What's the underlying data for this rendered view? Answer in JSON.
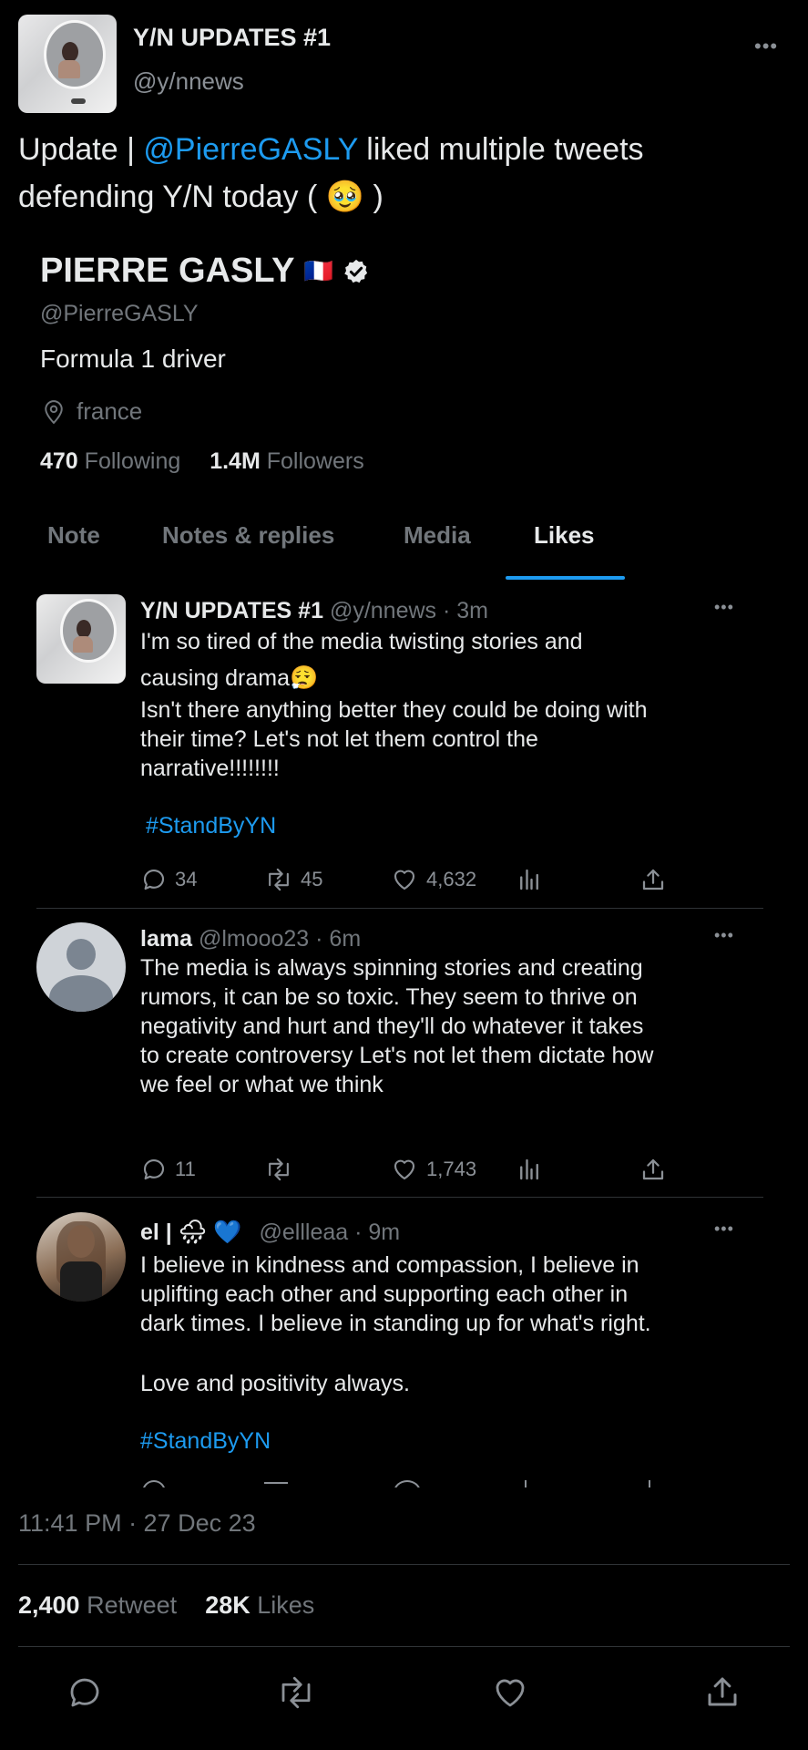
{
  "header": {
    "display_name": "Y/N UPDATES #1",
    "handle": "@y/nnews",
    "more_label": "•••"
  },
  "tweet": {
    "text_before": "Update | ",
    "mention": "@PierreGASLY",
    "text_after": " liked multiple tweets defending Y/N today ( 🥹 )"
  },
  "profile": {
    "name": "PIERRE GASLY",
    "flag": "🇫🇷",
    "handle": "@PierreGASLY",
    "bio": "Formula 1 driver",
    "location": "france",
    "following_count": "470",
    "following_label": "Following",
    "followers_count": "1.4M",
    "followers_label": "Followers",
    "tabs": [
      {
        "label": "Note",
        "active": false
      },
      {
        "label": "Notes & replies",
        "active": false
      },
      {
        "label": "Media",
        "active": false
      },
      {
        "label": "Likes",
        "active": true
      }
    ],
    "accent_color": "#1d9bf0"
  },
  "liked_tweets": [
    {
      "name": "Y/N UPDATES #1",
      "handle_time": "@y/nnews · 3m",
      "line1": "I'm so tired of the media twisting stories and",
      "line2": "causing drama😮‍💨",
      "line3": " Isn't there anything better they could be doing with\ntheir time? Let's not let them control the\nnarrative!!!!!!!!",
      "hashtag": "#StandByYN",
      "replies": "34",
      "retweets": "45",
      "likes": "4,632"
    },
    {
      "name": "lama",
      "handle_time": "@lmooo23 · 6m",
      "text": "The media is always spinning stories and creating\nrumors, it can be so toxic. They seem to thrive on\nnegativity and hurt and they'll do whatever it takes\nto create controversy Let's not let them dictate how\nwe feel or what we think",
      "replies": "11",
      "retweets": "",
      "likes": "1,743"
    },
    {
      "name": "el | 🌧 💙",
      "handle_time": "@ellleaa · 9m",
      "text": "I believe in kindness and compassion, I believe in\nuplifting each other and supporting each other in\ndark times. I believe in standing up for what's right.",
      "text2": " Love and positivity always.",
      "hashtag": "#StandByYN"
    }
  ],
  "meta": {
    "timestamp": "11:41 PM · 27 Dec 23",
    "retweet_count": "2,400",
    "retweet_label": "Retweet",
    "likes_count": "28K",
    "likes_label": "Likes"
  },
  "icons": {
    "location": "location-pin-icon",
    "verified": "verified-badge-icon",
    "reply": "reply-icon",
    "retweet": "retweet-icon",
    "like": "heart-icon",
    "views": "views-icon",
    "share": "share-icon"
  }
}
